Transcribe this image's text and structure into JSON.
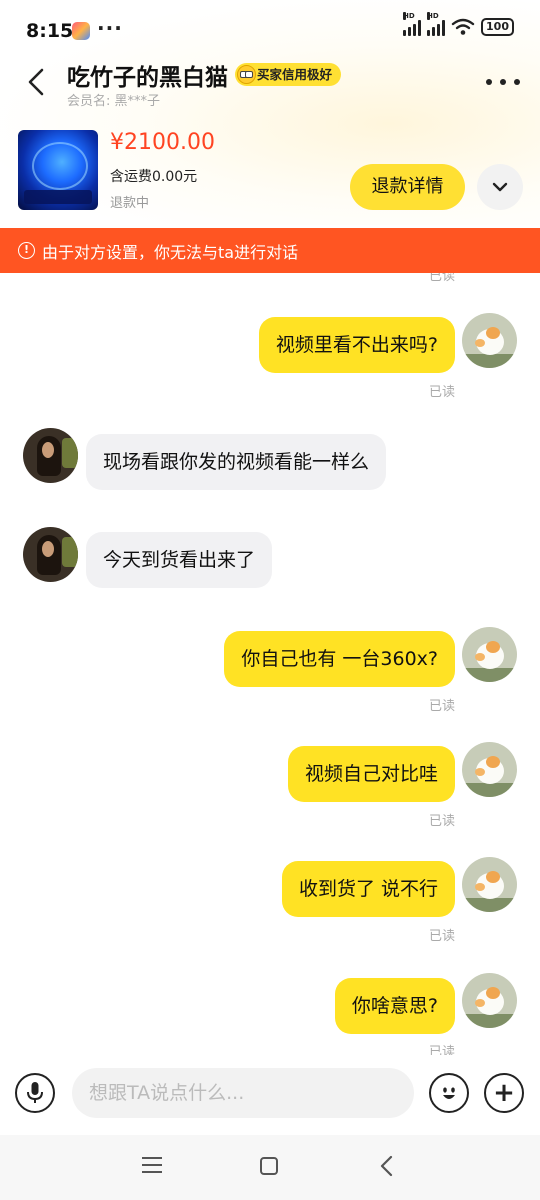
{
  "status_bar": {
    "time": "8:15",
    "more": "···",
    "signal_label_1": "HD",
    "signal_label_2": "HD",
    "battery": "100"
  },
  "header": {
    "title": "吃竹子的黑白猫",
    "credit_badge": "买家信用极好",
    "member": "会员名: 黑***子"
  },
  "product": {
    "price": "¥2100.00",
    "shipping": "含运费0.00元",
    "status": "退款中",
    "refund_button": "退款详情"
  },
  "warning": {
    "icon": "!",
    "text": "由于对方设置，你无法与ta进行对话"
  },
  "chat": {
    "top_read": "已读",
    "messages": [
      {
        "side": "out",
        "text": "视频里看不出来吗?",
        "read": "已读"
      },
      {
        "side": "in",
        "text": "现场看跟你发的视频看能一样么",
        "read": ""
      },
      {
        "side": "in",
        "text": "今天到货看出来了",
        "read": ""
      },
      {
        "side": "out",
        "text": "你自己也有 一台360x?",
        "read": "已读"
      },
      {
        "side": "out",
        "text": "视频自己对比哇",
        "read": "已读"
      },
      {
        "side": "out",
        "text": "收到货了 说不行",
        "read": "已读"
      },
      {
        "side": "out",
        "text": "你啥意思?",
        "read": "已读"
      }
    ]
  },
  "input": {
    "placeholder": "想跟TA说点什么...",
    "add": "+"
  },
  "colors": {
    "accent_yellow": "#ffe224",
    "warning_orange": "#ff5522",
    "price_red": "#ff4422"
  }
}
